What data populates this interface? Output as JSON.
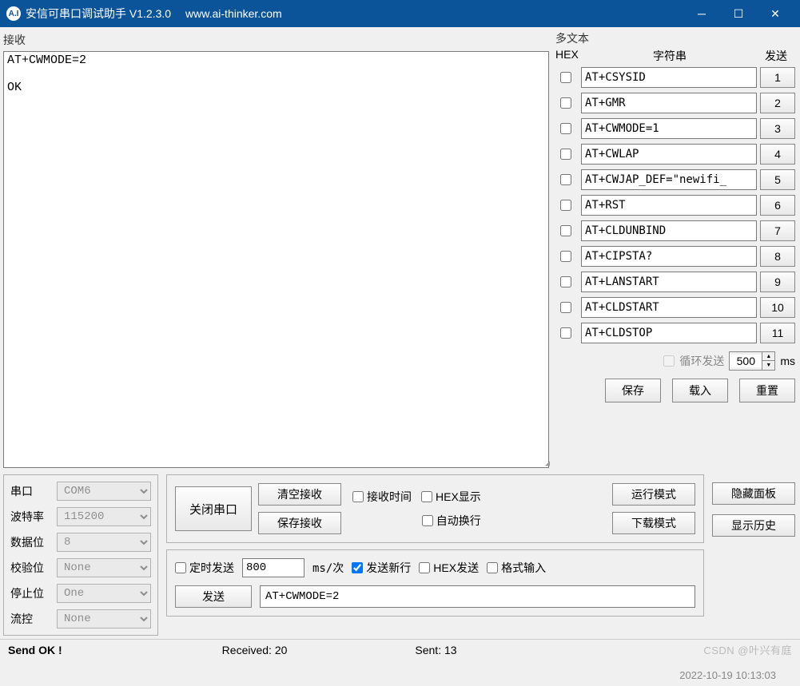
{
  "titlebar": {
    "icon_text": "A.I",
    "title": "安信可串口调试助手 V1.2.3.0",
    "url": "www.ai-thinker.com"
  },
  "receive": {
    "label": "接收",
    "content": "AT+CWMODE=2\n\nOK"
  },
  "multi": {
    "label": "多文本",
    "hex_header": "HEX",
    "str_header": "字符串",
    "send_header": "发送",
    "rows": [
      {
        "cmd": "AT+CSYSID",
        "idx": "1"
      },
      {
        "cmd": "AT+GMR",
        "idx": "2"
      },
      {
        "cmd": "AT+CWMODE=1",
        "idx": "3"
      },
      {
        "cmd": "AT+CWLAP",
        "idx": "4"
      },
      {
        "cmd": "AT+CWJAP_DEF=\"newifi_",
        "idx": "5"
      },
      {
        "cmd": "AT+RST",
        "idx": "6"
      },
      {
        "cmd": "AT+CLDUNBIND",
        "idx": "7"
      },
      {
        "cmd": "AT+CIPSTA?",
        "idx": "8"
      },
      {
        "cmd": "AT+LANSTART",
        "idx": "9"
      },
      {
        "cmd": "AT+CLDSTART",
        "idx": "10"
      },
      {
        "cmd": "AT+CLDSTOP",
        "idx": "11"
      }
    ],
    "loop_label": "循环发送",
    "loop_value": "500",
    "loop_unit": "ms",
    "save_btn": "保存",
    "load_btn": "载入",
    "reset_btn": "重置"
  },
  "port": {
    "com_lbl": "串口",
    "com_val": "COM6",
    "baud_lbl": "波特率",
    "baud_val": "115200",
    "data_lbl": "数据位",
    "data_val": "8",
    "parity_lbl": "校验位",
    "parity_val": "None",
    "stop_lbl": "停止位",
    "stop_val": "One",
    "flow_lbl": "流控",
    "flow_val": "None"
  },
  "mid": {
    "close_port": "关闭串口",
    "clear_recv": "清空接收",
    "save_recv": "保存接收",
    "recv_time": "接收时间",
    "hex_display": "HEX显示",
    "auto_wrap": "自动换行",
    "run_mode": "运行模式",
    "download_mode": "下载模式",
    "timed_send": "定时发送",
    "timer_val": "800",
    "timer_unit": "ms/次",
    "send_newline": "发送新行",
    "hex_send": "HEX发送",
    "format_input": "格式输入",
    "send_btn": "发送",
    "send_value": "AT+CWMODE=2"
  },
  "rightbtns": {
    "hide_panel": "隐藏面板",
    "show_history": "显示历史"
  },
  "status": {
    "send_ok": "Send OK !",
    "received": "Received: 20",
    "sent": "Sent: 13",
    "timestamp": "2022-10-19 10:13:03",
    "watermark": "CSDN @叶兴有庭"
  }
}
